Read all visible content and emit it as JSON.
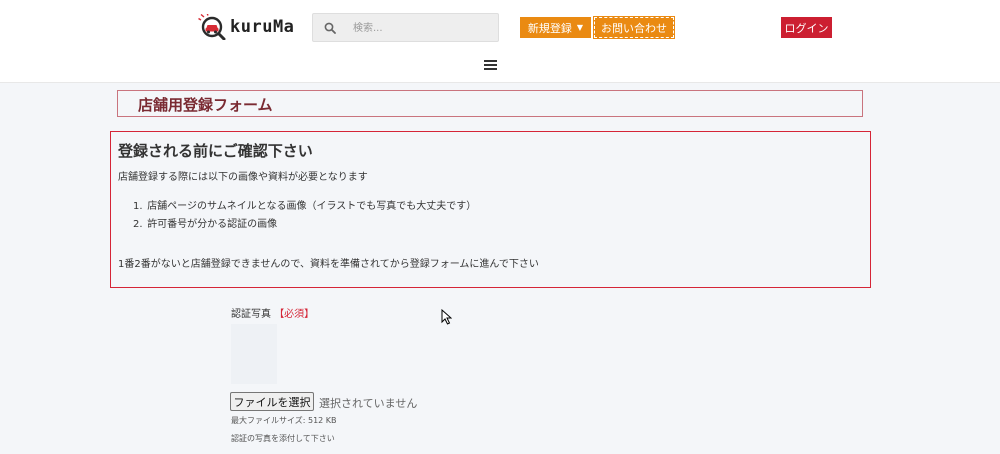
{
  "header": {
    "logo_text": "kuruMa",
    "search_placeholder": "検索...",
    "nav": {
      "register_label": "新規登録",
      "contact_label": "お問い合わせ"
    },
    "login_label": "ログイン",
    "menu_icon": "hamburger-icon"
  },
  "form": {
    "title": "店舗用登録フォーム",
    "notice": {
      "heading": "登録される前にご確認下さい",
      "intro": "店舗登録する際には以下の画像や資料が必要となります",
      "items": [
        {
          "num": "1.",
          "text": "店舗ページのサムネイルとなる画像（イラストでも写真でも大丈夫です）"
        },
        {
          "num": "2.",
          "text": "許可番号が分かる認証の画像"
        }
      ],
      "outro": "1番2番がないと店舗登録できませんので、資料を準備されてから登録フォームに進んで下さい"
    },
    "upload": {
      "label": "認証写真",
      "required": "【必須】",
      "button_label": "ファイルを選択",
      "status": "選択されていません",
      "max_size": "最大ファイルサイズ: 512 KB",
      "hint": "認証の写真を添付して下さい"
    }
  },
  "colors": {
    "accent_orange": "#ea8a12",
    "login_red": "#cc1f31",
    "notice_border": "#d52537"
  }
}
